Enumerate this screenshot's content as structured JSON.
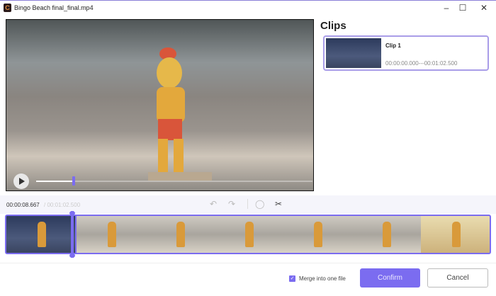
{
  "window": {
    "title": "Bingo Beach final_final.mp4",
    "minimize": "–",
    "maximize": "☐",
    "close": "✕"
  },
  "player": {
    "progress_fraction": 0.137
  },
  "clips": {
    "heading": "Clips",
    "items": [
      {
        "name": "Clip 1",
        "range": "00:00:00.000---00:01:02.500"
      }
    ]
  },
  "toolbar": {
    "current_time": "00:00:08.667",
    "total_time": "/ 00:01:02.500",
    "undo": "↶",
    "redo": "↷",
    "rotate": "◯",
    "cut": "✂"
  },
  "timeline": {
    "frame_count": 7
  },
  "footer": {
    "merge_label": "Merge into one file",
    "merge_checked": true,
    "confirm": "Confirm",
    "cancel": "Cancel"
  },
  "colors": {
    "accent": "#7b6cf0"
  }
}
